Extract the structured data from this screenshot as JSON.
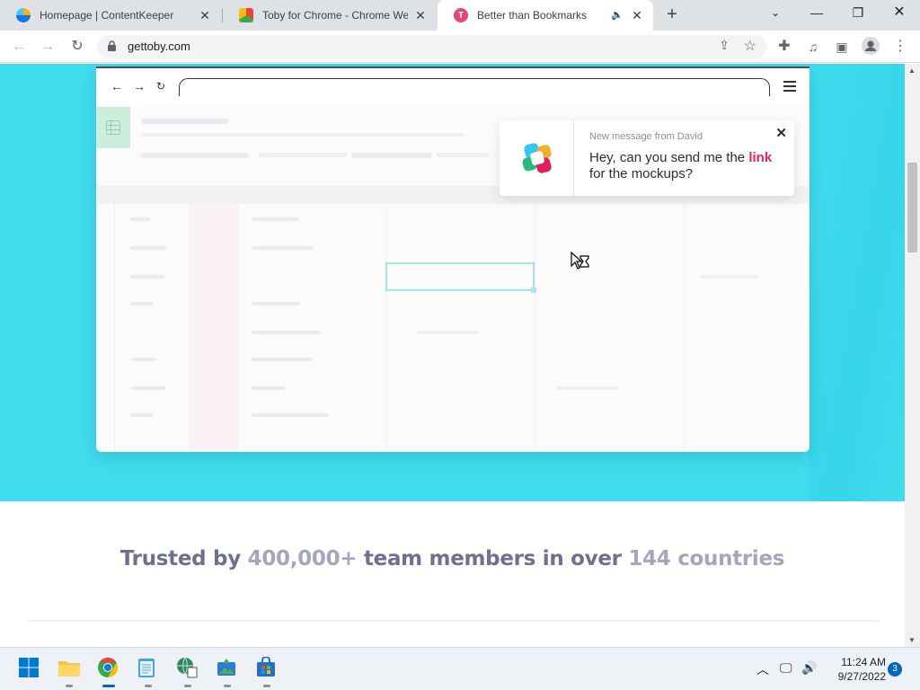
{
  "browser": {
    "tabs": [
      {
        "title": "Homepage | ContentKeeper",
        "favicon": "contentkeeper-icon",
        "active": false
      },
      {
        "title": "Toby for Chrome - Chrome Web",
        "favicon": "chrome-webstore-icon",
        "active": false
      },
      {
        "title": "Better than Bookmarks",
        "favicon": "toby-icon",
        "active": true
      }
    ],
    "url": "gettoby.com"
  },
  "page": {
    "notification": {
      "from": "New message from David",
      "message_pre": "Hey, can you send me the ",
      "message_link": "link",
      "message_post": " for the mockups?"
    },
    "trusted": {
      "pre": "Trusted by ",
      "members": "400,000+",
      "mid": " team members in over ",
      "countries": "144 countries"
    }
  },
  "taskbar": {
    "time": "11:24 AM",
    "date": "9/27/2022",
    "notification_count": "3"
  },
  "colors": {
    "hero_bg": "#3fdcee",
    "link": "#e0245e",
    "trusted_text": "#6d7090",
    "trusted_highlight": "#a3a6bd"
  }
}
